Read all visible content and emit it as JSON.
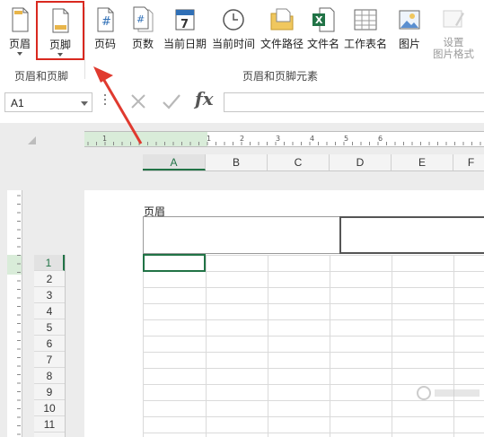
{
  "ribbon": {
    "buttons": {
      "header": "页眉",
      "footer": "页脚",
      "page_number": "页码",
      "page_count": "页数",
      "current_date": "当前日期",
      "current_time": "当前时间",
      "file_path": "文件路径",
      "file_name": "文件名",
      "sheet_name": "工作表名",
      "picture": "图片",
      "format_picture_line1": "设置",
      "format_picture_line2": "图片格式"
    },
    "groups": {
      "header_footer": "页眉和页脚",
      "elements": "页眉和页脚元素"
    },
    "icons": {
      "page_number_glyph": "#",
      "page_count_glyph": "#",
      "date_glyph": "7",
      "file_name_glyph": "X"
    }
  },
  "formula_bar": {
    "name_box": "A1",
    "fx": "fx",
    "value": ""
  },
  "ruler": {
    "numbers": [
      "1",
      "1",
      "2",
      "3",
      "4",
      "5",
      "6"
    ]
  },
  "sheet": {
    "columns": [
      "A",
      "B",
      "C",
      "D",
      "E",
      "F"
    ],
    "rows": [
      "1",
      "2",
      "3",
      "4",
      "5",
      "6",
      "7",
      "8",
      "9",
      "10",
      "11"
    ],
    "header_label": "页眉",
    "selected_cell": "A1"
  },
  "colors": {
    "accent": "#217346",
    "highlight": "#d9281f"
  }
}
